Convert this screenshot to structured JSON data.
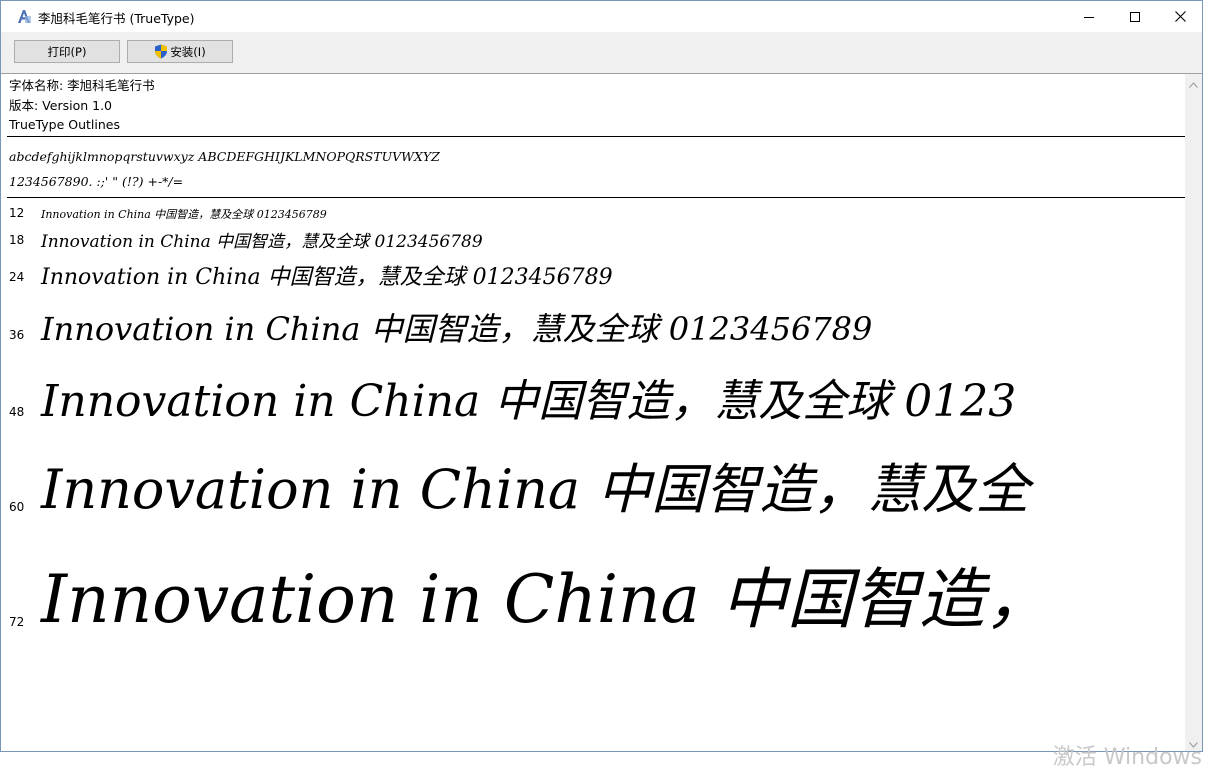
{
  "window": {
    "title": "李旭科毛笔行书 (TrueType)",
    "minimize_icon": "minimize-icon",
    "maximize_icon": "maximize-icon",
    "close_icon": "close-icon"
  },
  "toolbar": {
    "print_label": "打印(P)",
    "install_label": "安装(I)",
    "install_icon": "shield-icon"
  },
  "font_info": {
    "name_line": "字体名称: 李旭科毛笔行书",
    "version_line": "版本: Version 1.0",
    "outline_line": "TrueType Outlines"
  },
  "charset": {
    "letters": "abcdefghijklmnopqrstuvwxyz  ABCDEFGHIJKLMNOPQRSTUVWXYZ",
    "digits_symbols": "1234567890. :;' \" (!?) +-*/="
  },
  "samples": [
    {
      "size": "12",
      "text": "Innovation  in  China  中国智造，慧及全球  0123456789"
    },
    {
      "size": "18",
      "text": "Innovation  in  China  中国智造，慧及全球  0123456789"
    },
    {
      "size": "24",
      "text": "Innovation  in  China  中国智造，慧及全球  0123456789"
    },
    {
      "size": "36",
      "text": "Innovation  in  China  中国智造，慧及全球  0123456789"
    },
    {
      "size": "48",
      "text": "Innovation  in  China  中国智造，慧及全球  0123"
    },
    {
      "size": "60",
      "text": "Innovation  in  China  中国智造，慧及全"
    },
    {
      "size": "72",
      "text": "Innovation  in  China  中国智造，"
    }
  ],
  "watermark": "激活 Windows"
}
